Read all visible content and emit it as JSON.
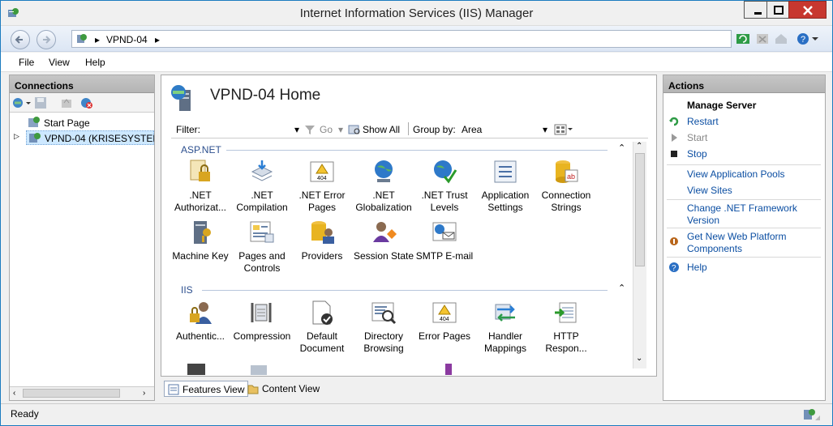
{
  "window": {
    "title": "Internet Information Services (IIS) Manager"
  },
  "address": {
    "crumbs": [
      "VPND-04"
    ]
  },
  "menu": {
    "items": [
      "File",
      "View",
      "Help"
    ]
  },
  "connections": {
    "header": "Connections",
    "tree": [
      {
        "label": "Start Page"
      },
      {
        "label": "VPND-04 (KRISESYSTEMS\\"
      }
    ]
  },
  "main": {
    "title": "VPND-04 Home",
    "filter_label": "Filter:",
    "go_label": "Go",
    "show_all_label": "Show All",
    "group_by_label": "Group by:",
    "group_by_value": "Area",
    "sections": [
      {
        "name": "ASP.NET",
        "features": [
          {
            "label": ".NET Authorizat...",
            "icon": "dotnet-authorization-icon"
          },
          {
            "label": ".NET Compilation",
            "icon": "dotnet-compilation-icon"
          },
          {
            "label": ".NET Error Pages",
            "icon": "dotnet-error-pages-icon"
          },
          {
            "label": ".NET Globalization",
            "icon": "dotnet-globalization-icon"
          },
          {
            "label": ".NET Trust Levels",
            "icon": "dotnet-trust-levels-icon"
          },
          {
            "label": "Application Settings",
            "icon": "application-settings-icon"
          },
          {
            "label": "Connection Strings",
            "icon": "connection-strings-icon"
          },
          {
            "label": "Machine Key",
            "icon": "machine-key-icon"
          },
          {
            "label": "Pages and Controls",
            "icon": "pages-and-controls-icon"
          },
          {
            "label": "Providers",
            "icon": "providers-icon"
          },
          {
            "label": "Session State",
            "icon": "session-state-icon"
          },
          {
            "label": "SMTP E-mail",
            "icon": "smtp-email-icon"
          }
        ]
      },
      {
        "name": "IIS",
        "features": [
          {
            "label": "Authentic...",
            "icon": "authentication-icon"
          },
          {
            "label": "Compression",
            "icon": "compression-icon"
          },
          {
            "label": "Default Document",
            "icon": "default-document-icon"
          },
          {
            "label": "Directory Browsing",
            "icon": "directory-browsing-icon"
          },
          {
            "label": "Error Pages",
            "icon": "error-pages-icon"
          },
          {
            "label": "Handler Mappings",
            "icon": "handler-mappings-icon"
          },
          {
            "label": "HTTP Respon...",
            "icon": "http-response-headers-icon"
          }
        ]
      }
    ]
  },
  "view_tabs": {
    "features": "Features View",
    "content": "Content View"
  },
  "actions": {
    "header": "Actions",
    "group_title": "Manage Server",
    "items": [
      {
        "label": "Restart",
        "enabled": true
      },
      {
        "label": "Start",
        "enabled": false
      },
      {
        "label": "Stop",
        "enabled": true
      },
      {
        "label": "View Application Pools",
        "enabled": true
      },
      {
        "label": "View Sites",
        "enabled": true
      },
      {
        "label": "Change .NET Framework Version",
        "enabled": true
      },
      {
        "label": "Get New Web Platform Components",
        "enabled": true
      },
      {
        "label": "Help",
        "enabled": true
      }
    ]
  },
  "status": {
    "text": "Ready"
  }
}
